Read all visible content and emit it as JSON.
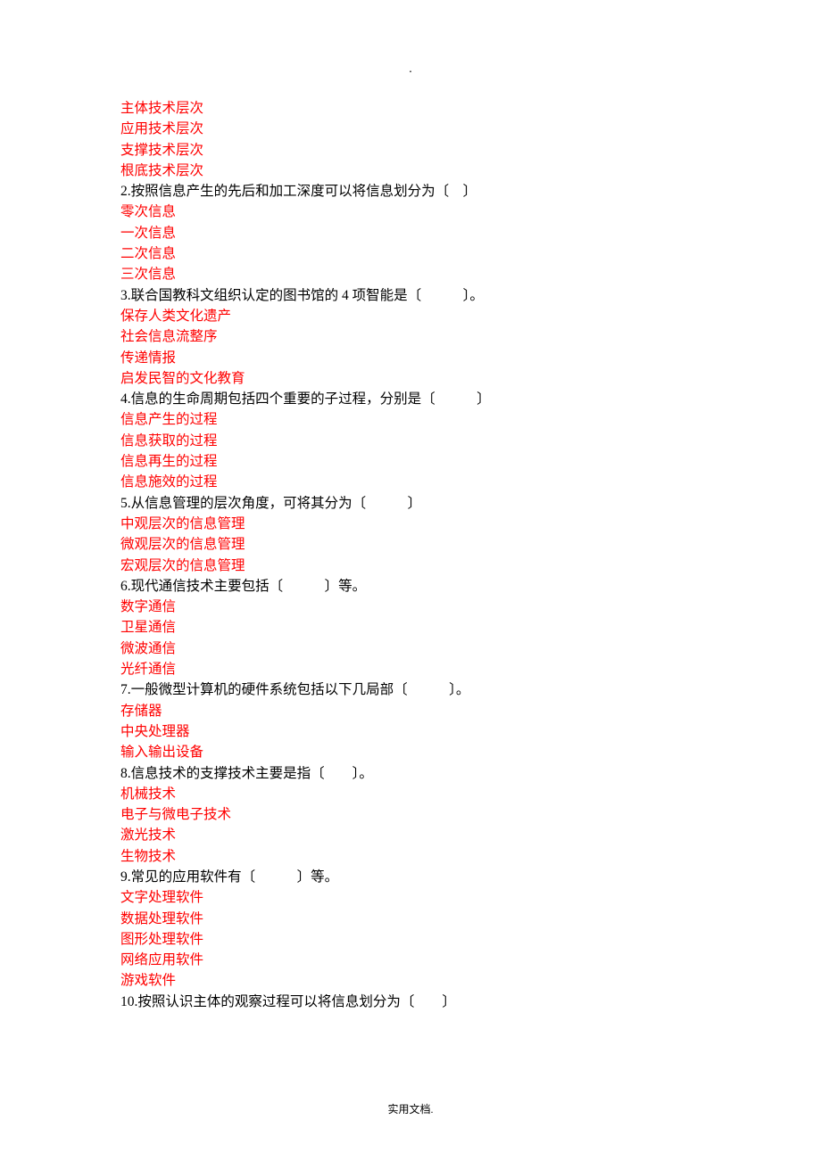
{
  "dot": ".",
  "footer": "实用文档.",
  "lines": [
    {
      "text": "主体技术层次",
      "color": "red"
    },
    {
      "text": "应用技术层次",
      "color": "red"
    },
    {
      "text": "支撑技术层次",
      "color": "red"
    },
    {
      "text": "根底技术层次",
      "color": "red"
    },
    {
      "text": "2.按照信息产生的先后和加工深度可以将信息划分为〔　〕",
      "color": "black"
    },
    {
      "text": "零次信息",
      "color": "red"
    },
    {
      "text": "一次信息",
      "color": "red"
    },
    {
      "text": "二次信息",
      "color": "red"
    },
    {
      "text": "三次信息",
      "color": "red"
    },
    {
      "text": "3.联合国教科文组织认定的图书馆的 4 项智能是〔　　　〕。",
      "color": "black"
    },
    {
      "text": "保存人类文化遗产",
      "color": "red"
    },
    {
      "text": "社会信息流整序",
      "color": "red"
    },
    {
      "text": "传递情报",
      "color": "red"
    },
    {
      "text": "启发民智的文化教育",
      "color": "red"
    },
    {
      "text": "4.信息的生命周期包括四个重要的子过程，分别是〔　　　〕",
      "color": "black"
    },
    {
      "text": "信息产生的过程",
      "color": "red"
    },
    {
      "text": "信息获取的过程",
      "color": "red"
    },
    {
      "text": "信息再生的过程",
      "color": "red"
    },
    {
      "text": "信息施效的过程",
      "color": "red"
    },
    {
      "text": "5.从信息管理的层次角度，可将其分为〔　　　〕",
      "color": "black"
    },
    {
      "text": "中观层次的信息管理",
      "color": "red"
    },
    {
      "text": "微观层次的信息管理",
      "color": "red"
    },
    {
      "text": "宏观层次的信息管理",
      "color": "red"
    },
    {
      "text": "6.现代通信技术主要包括〔　　　〕等。",
      "color": "black"
    },
    {
      "text": "数字通信",
      "color": "red"
    },
    {
      "text": "卫星通信",
      "color": "red"
    },
    {
      "text": "微波通信",
      "color": "red"
    },
    {
      "text": "光纤通信",
      "color": "red"
    },
    {
      "text": "7.一般微型计算机的硬件系统包括以下几局部〔　　　〕。",
      "color": "black"
    },
    {
      "text": "存储器",
      "color": "red"
    },
    {
      "text": "中央处理器",
      "color": "red"
    },
    {
      "text": "输入输出设备",
      "color": "red"
    },
    {
      "text": "8.信息技术的支撑技术主要是指〔　　〕。",
      "color": "black"
    },
    {
      "text": "机械技术",
      "color": "red"
    },
    {
      "text": "电子与微电子技术",
      "color": "red"
    },
    {
      "text": "激光技术",
      "color": "red"
    },
    {
      "text": "生物技术",
      "color": "red"
    },
    {
      "text": "9.常见的应用软件有〔　　　〕等。",
      "color": "black"
    },
    {
      "text": "文字处理软件",
      "color": "red"
    },
    {
      "text": "数据处理软件",
      "color": "red"
    },
    {
      "text": "图形处理软件",
      "color": "red"
    },
    {
      "text": "网络应用软件",
      "color": "red"
    },
    {
      "text": "游戏软件",
      "color": "red"
    },
    {
      "text": "10.按照认识主体的观察过程可以将信息划分为〔　　〕",
      "color": "black"
    }
  ]
}
